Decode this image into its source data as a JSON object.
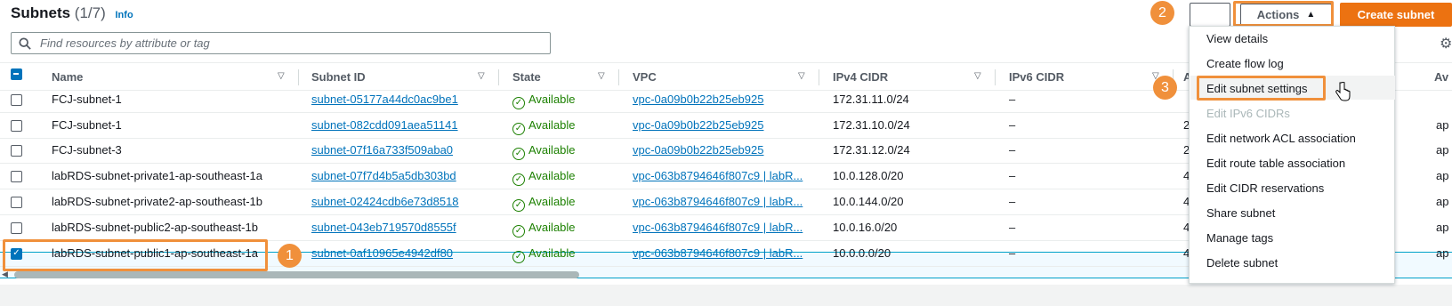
{
  "header": {
    "title": "Subnets",
    "count": "(1/7)",
    "info": "Info"
  },
  "search": {
    "placeholder": "Find resources by attribute or tag",
    "value": ""
  },
  "toolbar": {
    "actions_label": "Actions",
    "create_label": "Create subnet"
  },
  "columns": [
    "Name",
    "Subnet ID",
    "State",
    "VPC",
    "IPv4 CIDR",
    "IPv6 CIDR",
    "A",
    "Av"
  ],
  "rows": [
    {
      "selected": false,
      "name": "FCJ-subnet-1",
      "subnet_id": "subnet-05177a44dc0ac9be1",
      "state": "Available",
      "vpc": "vpc-0a09b0b22b25eb925",
      "ipv4": "172.31.11.0/24",
      "ipv6": "–",
      "peek": "",
      "peek2": ""
    },
    {
      "selected": false,
      "name": "FCJ-subnet-1",
      "subnet_id": "subnet-082cdd091aea51141",
      "state": "Available",
      "vpc": "vpc-0a09b0b22b25eb925",
      "ipv4": "172.31.10.0/24",
      "ipv6": "–",
      "peek": "2",
      "peek2": "ap"
    },
    {
      "selected": false,
      "name": "FCJ-subnet-3",
      "subnet_id": "subnet-07f16a733f509aba0",
      "state": "Available",
      "vpc": "vpc-0a09b0b22b25eb925",
      "ipv4": "172.31.12.0/24",
      "ipv6": "–",
      "peek": "2",
      "peek2": "ap"
    },
    {
      "selected": false,
      "name": "labRDS-subnet-private1-ap-southeast-1a",
      "subnet_id": "subnet-07f7d4b5a5db303bd",
      "state": "Available",
      "vpc": "vpc-063b8794646f807c9 | labR...",
      "ipv4": "10.0.128.0/20",
      "ipv6": "–",
      "peek": "4",
      "peek2": "ap"
    },
    {
      "selected": false,
      "name": "labRDS-subnet-private2-ap-southeast-1b",
      "subnet_id": "subnet-02424cdb6e73d8518",
      "state": "Available",
      "vpc": "vpc-063b8794646f807c9 | labR...",
      "ipv4": "10.0.144.0/20",
      "ipv6": "–",
      "peek": "4",
      "peek2": "ap"
    },
    {
      "selected": false,
      "name": "labRDS-subnet-public2-ap-southeast-1b",
      "subnet_id": "subnet-043eb719570d8555f",
      "state": "Available",
      "vpc": "vpc-063b8794646f807c9 | labR...",
      "ipv4": "10.0.16.0/20",
      "ipv6": "–",
      "peek": "4",
      "peek2": "ap"
    },
    {
      "selected": true,
      "name": "labRDS-subnet-public1-ap-southeast-1a",
      "subnet_id": "subnet-0af10965e4942df80",
      "state": "Available",
      "vpc": "vpc-063b8794646f807c9 | labR...",
      "ipv4": "10.0.0.0/20",
      "ipv6": "–",
      "peek": "4",
      "peek2": "ap"
    }
  ],
  "menu": {
    "items": [
      {
        "label": "View details",
        "disabled": false
      },
      {
        "label": "Create flow log",
        "disabled": false
      },
      {
        "label": "Edit subnet settings",
        "disabled": false
      },
      {
        "label": "Edit IPv6 CIDRs",
        "disabled": true
      },
      {
        "label": "Edit network ACL association",
        "disabled": false
      },
      {
        "label": "Edit route table association",
        "disabled": false
      },
      {
        "label": "Edit CIDR reservations",
        "disabled": false
      },
      {
        "label": "Share subnet",
        "disabled": false
      },
      {
        "label": "Manage tags",
        "disabled": false
      },
      {
        "label": "Delete subnet",
        "disabled": false
      }
    ]
  },
  "steps": [
    "1",
    "2",
    "3"
  ],
  "colors": {
    "accent": "#ec7211",
    "highlight": "#f0903b",
    "link": "#0073bb",
    "success": "#1d8102"
  },
  "icons": [
    "search-icon",
    "refresh-icon",
    "gear-icon",
    "filter-icon",
    "check-circle-icon",
    "pointer-cursor-icon"
  ]
}
